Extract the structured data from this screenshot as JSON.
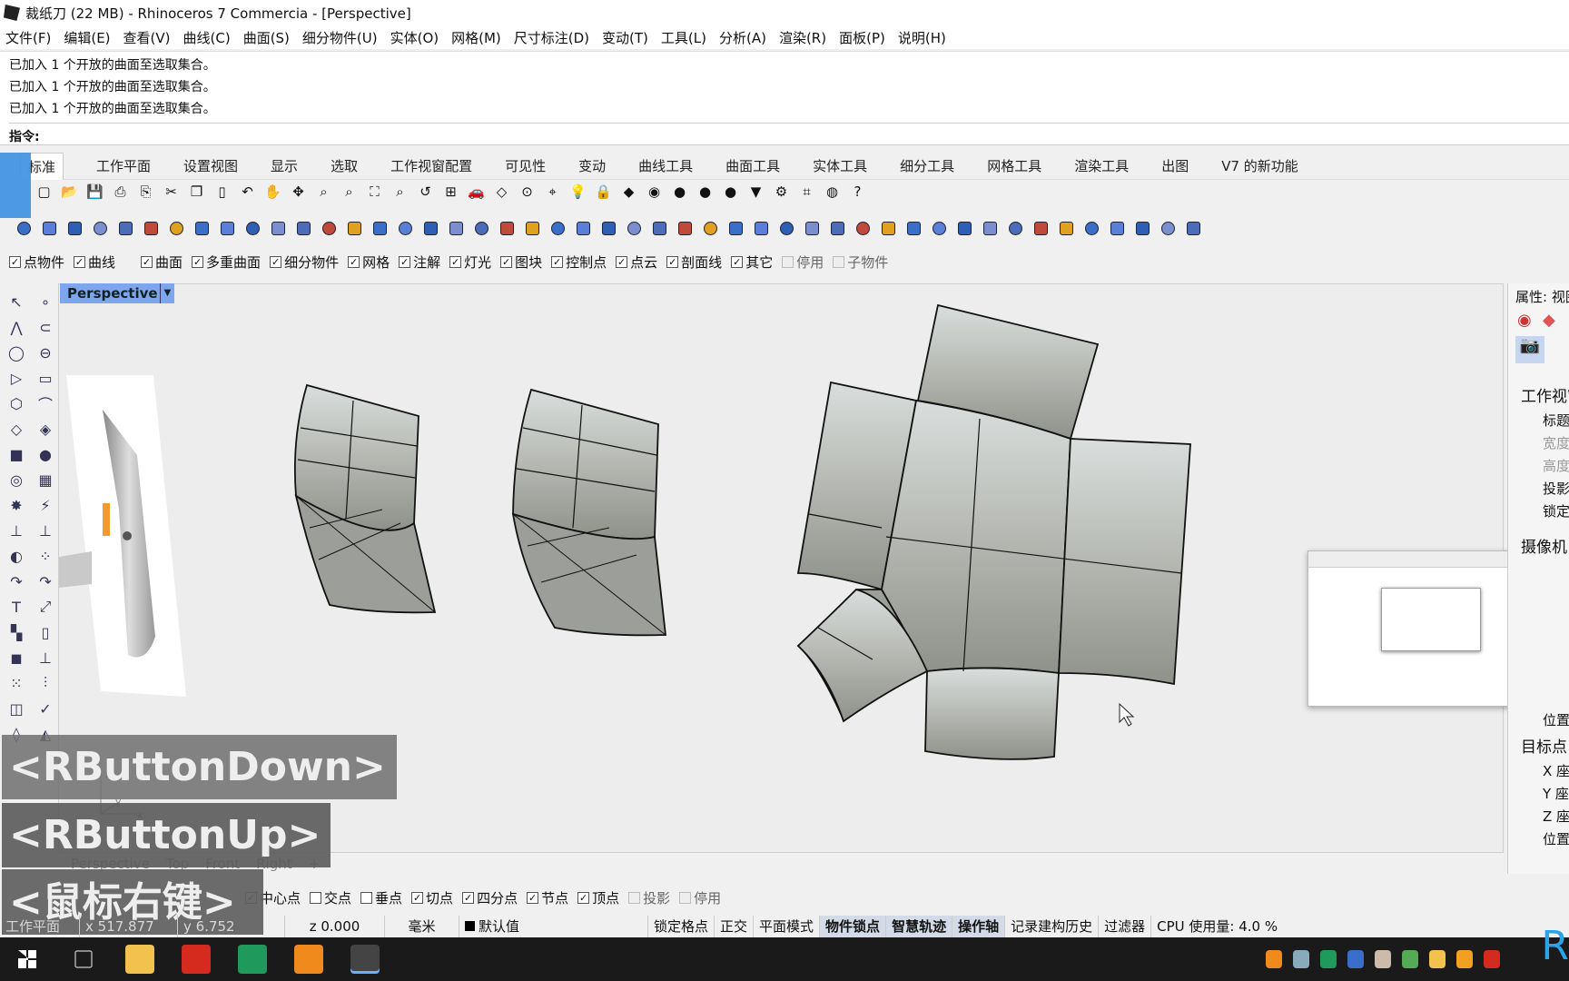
{
  "window": {
    "title": "裁纸刀 (22 MB) - Rhinoceros 7 Commercia - [Perspective]"
  },
  "menu": [
    "文件(F)",
    "编辑(E)",
    "查看(V)",
    "曲线(C)",
    "曲面(S)",
    "细分物件(U)",
    "实体(O)",
    "网格(M)",
    "尺寸标注(D)",
    "变动(T)",
    "工具(L)",
    "分析(A)",
    "渲染(R)",
    "面板(P)",
    "说明(H)"
  ],
  "command": {
    "history": [
      "已加入 1 个开放的曲面至选取集合。",
      "已加入 1 个开放的曲面至选取集合。",
      "已加入 1 个开放的曲面至选取集合。"
    ],
    "prompt": "指令:"
  },
  "tabs": [
    {
      "label": "标准",
      "active": true
    },
    {
      "label": "工作平面"
    },
    {
      "label": "设置视图"
    },
    {
      "label": "显示"
    },
    {
      "label": "选取"
    },
    {
      "label": "工作视窗配置"
    },
    {
      "label": "可见性"
    },
    {
      "label": "变动"
    },
    {
      "label": "曲线工具"
    },
    {
      "label": "曲面工具"
    },
    {
      "label": "实体工具"
    },
    {
      "label": "细分工具"
    },
    {
      "label": "网格工具"
    },
    {
      "label": "渲染工具"
    },
    {
      "label": "出图"
    },
    {
      "label": "V7 的新功能"
    }
  ],
  "toolbar1": [
    {
      "icon": "new-icon",
      "g": "▢"
    },
    {
      "icon": "open-icon",
      "g": "📂"
    },
    {
      "icon": "save-icon",
      "g": "💾"
    },
    {
      "icon": "print-icon",
      "g": "⎙"
    },
    {
      "icon": "export-icon",
      "g": "⎘"
    },
    {
      "icon": "cut-icon",
      "g": "✂"
    },
    {
      "icon": "copy-icon",
      "g": "❐"
    },
    {
      "icon": "paste-icon",
      "g": "▯"
    },
    {
      "icon": "undo-icon",
      "g": "↶"
    },
    {
      "icon": "pan-icon",
      "g": "✋"
    },
    {
      "icon": "rotate-view-icon",
      "g": "✥"
    },
    {
      "icon": "zoom-icon",
      "g": "⌕"
    },
    {
      "icon": "zoom-window-icon",
      "g": "⌕"
    },
    {
      "icon": "zoom-extents-icon",
      "g": "⛶"
    },
    {
      "icon": "zoom-selected-icon",
      "g": "⌕"
    },
    {
      "icon": "undo-view-icon",
      "g": "↺"
    },
    {
      "icon": "viewport-layout-icon",
      "g": "⊞"
    },
    {
      "icon": "car-icon",
      "g": "🚗"
    },
    {
      "icon": "cplane-icon",
      "g": "◇"
    },
    {
      "icon": "point-icon",
      "g": "⊙"
    },
    {
      "icon": "select-icon",
      "g": "⌖"
    },
    {
      "icon": "light-icon",
      "g": "💡"
    },
    {
      "icon": "lock-icon",
      "g": "🔒"
    },
    {
      "icon": "layer-icon",
      "g": "◆"
    },
    {
      "icon": "color-wheel-icon",
      "g": "◉"
    },
    {
      "icon": "render-sphere-icon",
      "g": "●"
    },
    {
      "icon": "shaded-sphere-icon",
      "g": "●"
    },
    {
      "icon": "blue-sphere-icon",
      "g": "●"
    },
    {
      "icon": "filter-icon",
      "g": "▼"
    },
    {
      "icon": "gear-icon",
      "g": "⚙"
    },
    {
      "icon": "dimension-icon",
      "g": "⌗"
    },
    {
      "icon": "globe-icon",
      "g": "◍"
    },
    {
      "icon": "help-icon",
      "g": "?"
    }
  ],
  "toolbar2": [
    "box-icon",
    "box-edge-icon",
    "cone-icon",
    "drop-icon",
    "cylinder-icon",
    "sphere-icon",
    "ellipsoid-icon",
    "torus-icon",
    "box-3d-icon",
    "revolve-icon",
    "sweep-icon",
    "extrude-icon",
    "pyramid-icon",
    "loft-icon",
    "patch-icon",
    "control-points-icon",
    "surface-icon",
    "solid-icon",
    "boolean-icon",
    "join-icon",
    "blend-icon",
    "mesh-icon",
    "mesh-sphere-icon",
    "project-icon",
    "cup-icon",
    "bridge-icon",
    "chain-icon",
    "offset-icon",
    "knife-icon",
    "ellipse-icon",
    "plane-icon",
    "shell-icon",
    "grid-icon",
    "list-icon",
    "tools-icon",
    "puzzle-icon",
    "render-icon",
    "arrow-icon",
    "earth-icon",
    "paint-icon",
    "brush-icon",
    "cap-icon",
    "light-bulb-icon",
    "environment-icon",
    "disable-icon",
    "funnel-icon",
    "snap-icon"
  ],
  "filters": [
    {
      "label": "点物件",
      "checked": true
    },
    {
      "label": "曲线",
      "checked": true
    },
    {
      "label": "曲面",
      "checked": true
    },
    {
      "label": "多重曲面",
      "checked": true
    },
    {
      "label": "细分物件",
      "checked": true
    },
    {
      "label": "网格",
      "checked": true
    },
    {
      "label": "注解",
      "checked": true
    },
    {
      "label": "灯光",
      "checked": true
    },
    {
      "label": "图块",
      "checked": true
    },
    {
      "label": "控制点",
      "checked": true
    },
    {
      "label": "点云",
      "checked": true
    },
    {
      "label": "剖面线",
      "checked": true
    },
    {
      "label": "其它",
      "checked": true
    },
    {
      "label": "停用",
      "checked": false
    },
    {
      "label": "子物件",
      "checked": false
    }
  ],
  "lefttools": [
    "select-arrow-icon",
    "point-icon",
    "polyline-icon",
    "curve-icon",
    "circle-icon",
    "ellipse-icon",
    "polygon-icon",
    "rectangle-icon",
    "hexagon-icon",
    "fillet-curve-icon",
    "surface-corner-icon",
    "surface-extrude-icon",
    "box-icon",
    "boolean-union-icon",
    "cylinder-ring-icon",
    "surface-patch-icon",
    "explode-icon",
    "split-icon",
    "trim-icon",
    "extend-icon",
    "group-icon",
    "ungroup-icon",
    "fillet-icon",
    "offset-curve-icon",
    "text-icon",
    "scale-icon",
    "array-icon",
    "align-icon",
    "solid-box-icon",
    "dimension-icon",
    "grid-array-icon",
    "transform-icon",
    "analyze-icon",
    "check-icon",
    "mesh-icon",
    "render-icon"
  ],
  "viewport": {
    "name": "Perspective",
    "axes": [
      "z",
      "y",
      "x"
    ]
  },
  "viewport_tabs": [
    "Perspective",
    "Top",
    "Front",
    "Right",
    "+"
  ],
  "osnap": [
    {
      "label": "中心点",
      "checked": true
    },
    {
      "label": "交点",
      "checked": false
    },
    {
      "label": "垂点",
      "checked": false
    },
    {
      "label": "切点",
      "checked": true
    },
    {
      "label": "四分点",
      "checked": true
    },
    {
      "label": "节点",
      "checked": true
    },
    {
      "label": "顶点",
      "checked": true
    },
    {
      "label": "投影",
      "checked": false,
      "disabled": true
    },
    {
      "label": "停用",
      "checked": false,
      "disabled": true
    }
  ],
  "status": {
    "cplane": "工作平面",
    "x": "x 517.877",
    "y": "y 6.752",
    "z": "z 0.000",
    "units": "毫米",
    "layer": "默认值",
    "toggles": [
      {
        "label": "锁定格点",
        "on": false
      },
      {
        "label": "正交",
        "on": false
      },
      {
        "label": "平面模式",
        "on": false
      },
      {
        "label": "物件锁点",
        "on": true
      },
      {
        "label": "智慧轨迹",
        "on": true
      },
      {
        "label": "操作轴",
        "on": true
      },
      {
        "label": "记录建构历史",
        "on": false
      },
      {
        "label": "过滤器",
        "on": false
      }
    ],
    "cpu": "CPU 使用量: 4.0 %"
  },
  "rightpanel": {
    "title": "属性: 视图",
    "section1": "工作视窗",
    "rows1": [
      "标题",
      "宽度",
      "高度",
      "投影",
      "锁定"
    ],
    "section2": "摄像机",
    "row_pos": "位置",
    "section3": "目标点",
    "rows3": [
      "X 座标",
      "Y 座标",
      "Z 座标",
      "位置"
    ]
  },
  "overlays": [
    "<RButtonDown>",
    "<RButtonUp>",
    "<鼠标右键>"
  ],
  "taskbar": {
    "apps": [
      "start-icon",
      "task-view-icon",
      "file-explorer-icon",
      "wps-icon",
      "recorder-icon",
      "search-app-icon",
      "rhino-icon"
    ],
    "colors": {
      "wps": "#d52b1e",
      "recorder": "#1f9a5c",
      "search": "#f08a1c"
    }
  },
  "colors": {
    "accent": "#7ea6ec",
    "tab_blue": "#3b8fe0"
  }
}
